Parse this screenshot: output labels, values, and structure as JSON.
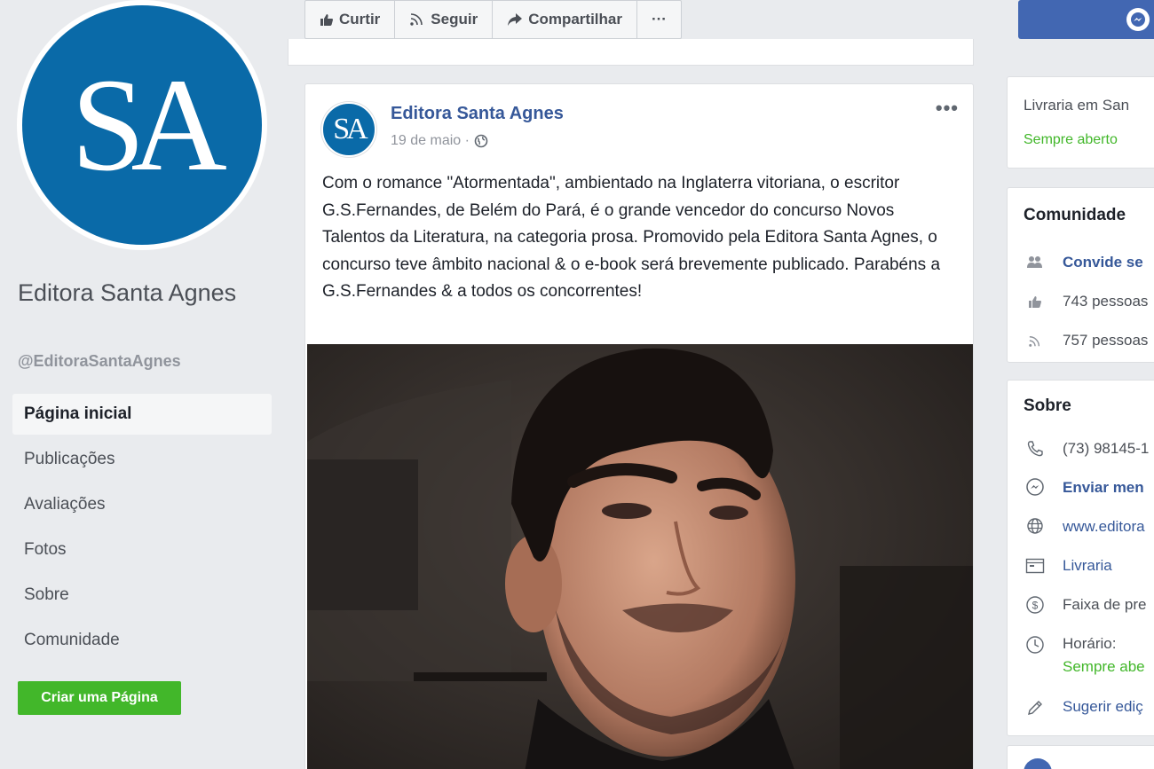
{
  "colors": {
    "brand_blue": "#0a6aa8",
    "link_blue": "#365899",
    "fb_blue": "#4267b2",
    "green": "#42b72a",
    "background": "#e9ebee"
  },
  "sidebar": {
    "logo_text": "SA",
    "page_name": "Editora Santa Agnes",
    "page_handle": "@EditoraSantaAgnes",
    "nav": [
      {
        "label": "Página inicial",
        "active": true
      },
      {
        "label": "Publicações"
      },
      {
        "label": "Avaliações"
      },
      {
        "label": "Fotos"
      },
      {
        "label": "Sobre"
      },
      {
        "label": "Comunidade"
      }
    ],
    "create_page": "Criar uma Página"
  },
  "actions": {
    "like": "Curtir",
    "follow": "Seguir",
    "share": "Compartilhar",
    "more": "···"
  },
  "post": {
    "avatar_text": "SA",
    "author": "Editora Santa Agnes",
    "date": "19 de maio ·",
    "more": "•••",
    "text": "Com o romance \"Atormentada\", ambientado na Inglaterra vitoriana, o escritor G.S.Fernandes, de Belém do Pará, é o grande vencedor do concurso Novos Talentos da Literatura, na categoria prosa. Promovido pela Editora Santa Agnes, o concurso teve âmbito nacional & o e-book será brevemente publicado. Parabéns a G.S.Fernandes & a todos os concorrentes!"
  },
  "right": {
    "category_line": "Livraria em San",
    "always_open": "Sempre aberto",
    "community": {
      "title": "Comunidade",
      "invite": "Convide se",
      "likes": "743 pessoas",
      "follows": "757 pessoas"
    },
    "about": {
      "title": "Sobre",
      "phone": "(73) 98145-1",
      "send_message": "Enviar men",
      "website": "www.editora",
      "category": "Livraria",
      "price_range": "Faixa de pre",
      "hours_label": "Horário:",
      "hours_value": "Sempre abe",
      "suggest": "Sugerir ediç"
    }
  }
}
